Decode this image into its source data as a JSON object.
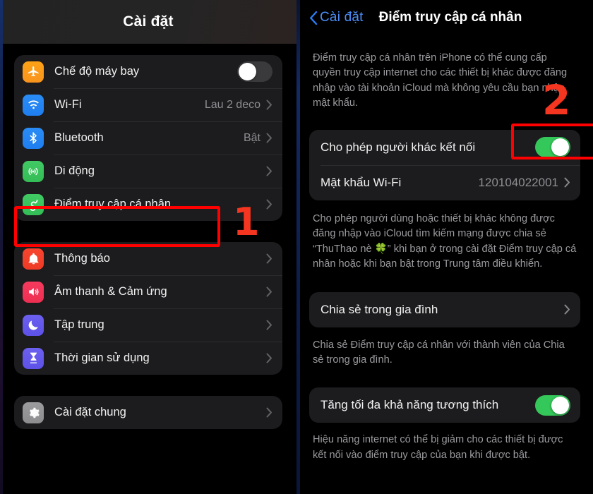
{
  "left": {
    "nav_title": "Cài đặt",
    "groups": [
      {
        "rows": [
          {
            "label": "Chế độ máy bay",
            "icon": "airplane-icon",
            "control": "toggle-off",
            "value": "",
            "chevron": false
          },
          {
            "label": "Wi-Fi",
            "icon": "wifi-icon",
            "control": "value",
            "value": "Lau 2 deco",
            "chevron": true
          },
          {
            "label": "Bluetooth",
            "icon": "bluetooth-icon",
            "control": "value",
            "value": "Bật",
            "chevron": true
          },
          {
            "label": "Di động",
            "icon": "cellular-icon",
            "control": "none",
            "value": "",
            "chevron": true
          },
          {
            "label": "Điểm truy cập cá nhân",
            "icon": "hotspot-icon",
            "control": "none",
            "value": "",
            "chevron": true
          }
        ]
      },
      {
        "rows": [
          {
            "label": "Thông báo",
            "icon": "bell-icon",
            "control": "none",
            "value": "",
            "chevron": true
          },
          {
            "label": "Âm thanh & Cảm ứng",
            "icon": "speaker-icon",
            "control": "none",
            "value": "",
            "chevron": true
          },
          {
            "label": "Tập trung",
            "icon": "moon-icon",
            "control": "none",
            "value": "",
            "chevron": true
          },
          {
            "label": "Thời gian sử dụng",
            "icon": "hourglass-icon",
            "control": "none",
            "value": "",
            "chevron": true
          }
        ]
      },
      {
        "rows": [
          {
            "label": "Cài đặt chung",
            "icon": "gear-icon",
            "control": "none",
            "value": "",
            "chevron": true
          }
        ]
      }
    ]
  },
  "right": {
    "back_label": "Cài đặt",
    "nav_title": "Điểm truy cập cá nhân",
    "intro_text": "Điểm truy cập cá nhân trên iPhone có thể cung cấp quyền truy cập internet cho các thiết bị khác được đăng nhập vào tài khoản iCloud mà không yêu cầu bạn nhập mật khẩu.",
    "allow_others_label": "Cho phép người khác kết nối",
    "wifi_password_label": "Mật khẩu Wi-Fi",
    "wifi_password_value": "120104022001",
    "allow_others_footer": "Cho phép người dùng hoặc thiết bị khác không được đăng nhập vào iCloud tìm kiếm mạng được chia sẻ “ThuThao nè 🍀” khi bạn ở trong cài đặt Điểm truy cập cá nhân hoặc khi bạn bật trong Trung tâm điều khiển.",
    "family_sharing_label": "Chia sẻ trong gia đình",
    "family_sharing_footer": "Chia sẻ Điểm truy cập cá nhân với thành viên của Chia sẻ trong gia đình.",
    "max_compat_label": "Tăng tối đa khả năng tương thích",
    "max_compat_footer": "Hiệu năng internet có thể bị giảm cho các thiết bị được kết nối vào điểm truy cập của bạn khi được bật."
  },
  "annotations": {
    "step1": "1",
    "step2": "2",
    "highlight_color": "#fe0000",
    "number_color": "#f4351f"
  },
  "colors": {
    "background": "#000000",
    "card": "#1c1c1e",
    "toggle_on": "#34c759",
    "toggle_off": "#3a3a3c",
    "accent_blue": "#4b8ef8",
    "secondary_text": "#8e8e93"
  }
}
